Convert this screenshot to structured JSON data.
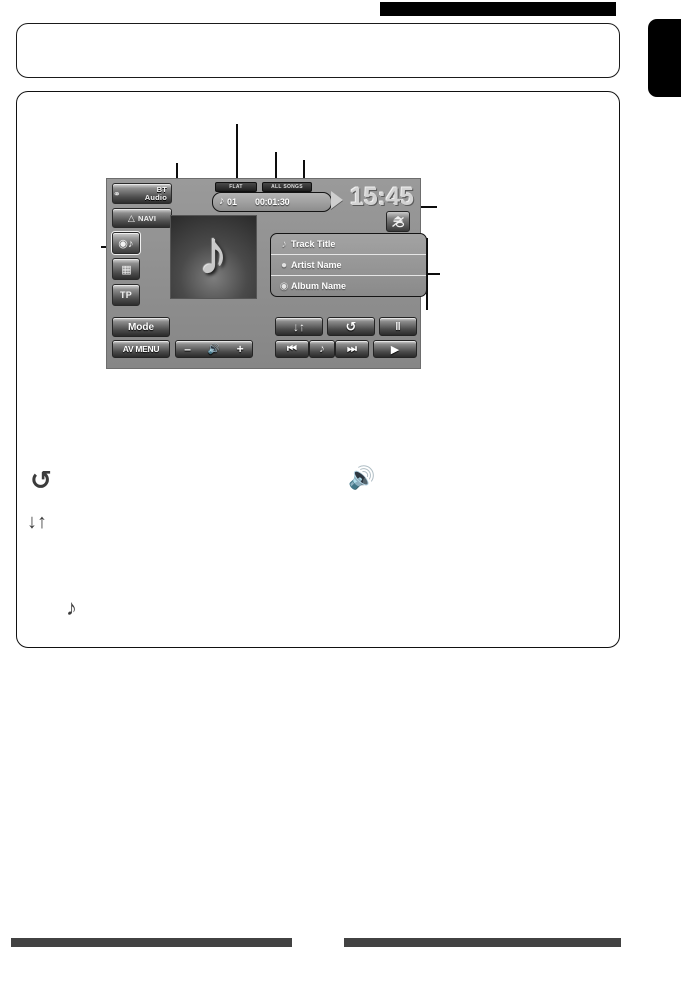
{
  "page": {
    "header_bar": "",
    "side_tab": "",
    "footer_left": "",
    "footer_right": ""
  },
  "device": {
    "rail": [
      {
        "id": "bt-audio",
        "label": "BT\nAudio",
        "line1": "BT",
        "line2": "Audio",
        "icon": "bluetooth-icon",
        "active": false
      },
      {
        "id": "navi",
        "label": "NAVI",
        "icon": "navi-arrow-icon",
        "active": false
      },
      {
        "id": "source-disc",
        "label": "",
        "icon": "disc-music-icon",
        "active": true
      },
      {
        "id": "keypad",
        "label": "",
        "icon": "keypad-grid-icon",
        "active": false
      },
      {
        "id": "tp",
        "label": "TP",
        "icon": "tp-icon",
        "active": false
      }
    ],
    "status": {
      "eq_tag": "FLAT",
      "mode_tag": "ALL SONGS",
      "track_number": "01",
      "elapsed_time": "00:01:30",
      "track_note_icon": "music-note-icon",
      "play_state_icon": "play-triangle-icon",
      "clock": "15:45",
      "eject_icon": "disc-eject-icon"
    },
    "artwork": {
      "placeholder_icon": "music-note-icon"
    },
    "info": [
      {
        "icon": "music-note-icon",
        "label": "Track Title"
      },
      {
        "icon": "person-icon",
        "label": "Artist Name"
      },
      {
        "icon": "disc-icon",
        "label": "Album Name"
      }
    ],
    "controls": {
      "mode": "Mode",
      "av_menu": "AV MENU",
      "volume_down": "–",
      "volume_icon": "speaker-volume-icon",
      "volume_up": "+",
      "sort": "↓↑",
      "repeat": "↺",
      "pause": "‖",
      "previous": "⏮",
      "note": "♪",
      "next": "⏭",
      "play": "▶"
    }
  },
  "legend_icons": [
    {
      "name": "repeat-icon",
      "glyph": "↺"
    },
    {
      "name": "shuffle-sort-icon",
      "glyph": "↓↑"
    },
    {
      "name": "speaker-volume-icon",
      "glyph": "🔊"
    },
    {
      "name": "music-note-icon",
      "glyph": "♪"
    }
  ],
  "colors": {
    "screen_bg": "#8f8f8f",
    "button_dark": "#2b2b2b",
    "text_light": "#ffffff",
    "ink": "#0d0d0d",
    "bar_dark": "#424242"
  }
}
